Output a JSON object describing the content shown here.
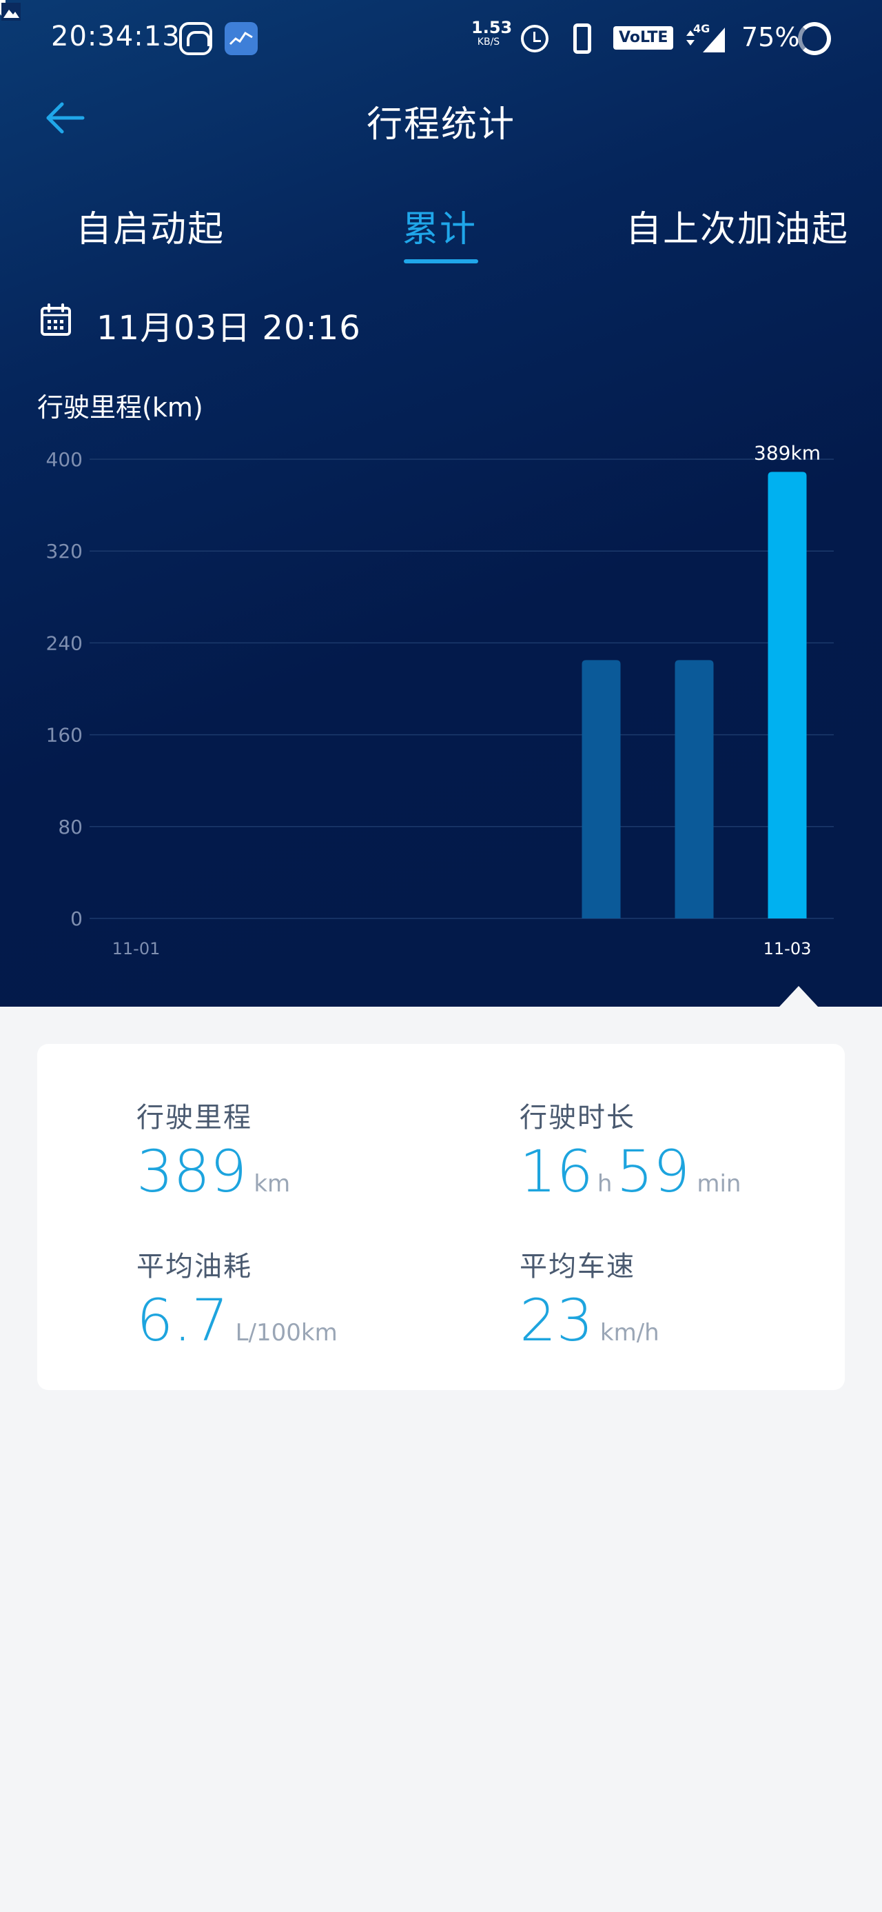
{
  "status_bar": {
    "time": "20:34:13",
    "net_speed_value": "1.53",
    "net_speed_unit": "KB/S",
    "volte": "VoLTE",
    "network": "4G",
    "battery": "75%",
    "icons": [
      "car-app-icon",
      "chart-app-icon",
      "image-icon",
      "alarm-icon",
      "phone-icon",
      "signal-icon",
      "battery-icon"
    ]
  },
  "header": {
    "title": "行程统计"
  },
  "tabs": [
    {
      "label": "自启动起",
      "active": false
    },
    {
      "label": "累计",
      "active": true
    },
    {
      "label": "自上次加油起",
      "active": false
    }
  ],
  "date": {
    "text": "11月03日 20:16"
  },
  "chart_data": {
    "type": "bar",
    "title": "行驶里程(km)",
    "ylabel": "",
    "xlabel": "",
    "ylim": [
      0,
      400
    ],
    "yticks": [
      0,
      80,
      160,
      240,
      320,
      400
    ],
    "categories": [
      "",
      "",
      "",
      "",
      "",
      "",
      "",
      ""
    ],
    "values": [
      0,
      0,
      0,
      0,
      0,
      225,
      225,
      389
    ],
    "x_tick_labels": [
      {
        "index": 0,
        "label": "11-01"
      },
      {
        "index": 7,
        "label": "11-03"
      }
    ],
    "highlight_index": 7,
    "data_labels": [
      {
        "index": 7,
        "label": "389km"
      }
    ],
    "grid": true,
    "colors": {
      "bar": "#0b5a99",
      "bar_highlight": "#00b1f0",
      "grid": "#1c3a6c"
    }
  },
  "stats": {
    "mileage": {
      "label": "行驶里程",
      "value": "389",
      "unit": "km"
    },
    "duration": {
      "label": "行驶时长",
      "hours": "16",
      "hours_unit": "h",
      "minutes": "59",
      "minutes_unit": "min"
    },
    "fuel": {
      "label": "平均油耗",
      "value": "6.7",
      "unit": "L/100km"
    },
    "speed": {
      "label": "平均车速",
      "value": "23",
      "unit": "km/h"
    }
  },
  "colors": {
    "accent": "#20a7ea",
    "number": "#1da4de"
  }
}
